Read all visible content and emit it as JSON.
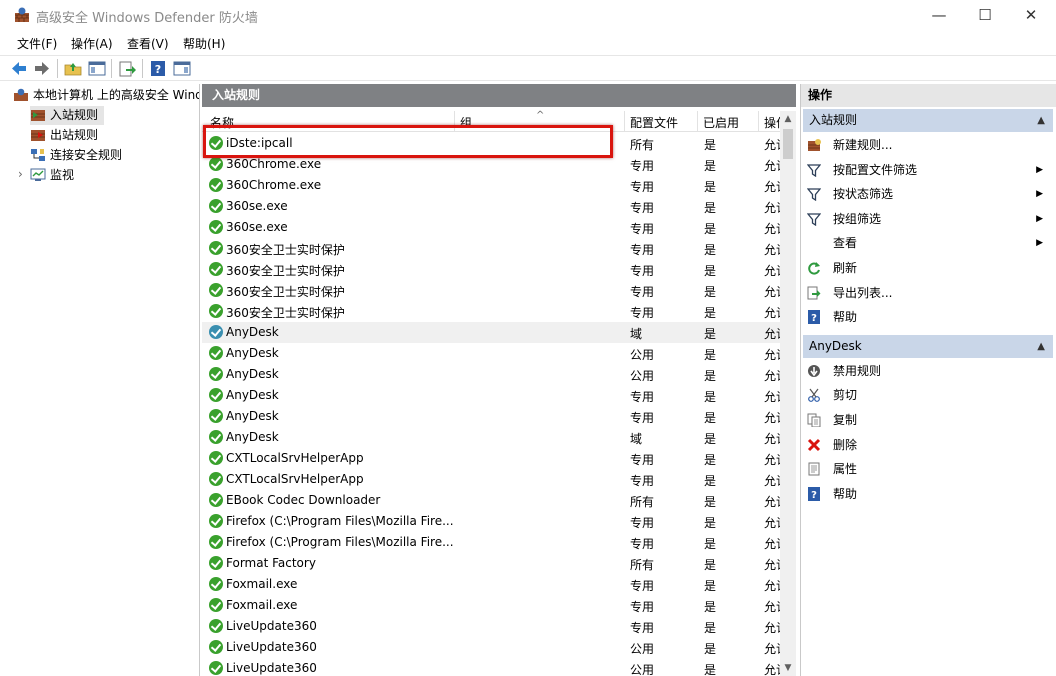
{
  "window": {
    "title": "高级安全 Windows Defender 防火墙",
    "min_glyph": "—",
    "max_glyph": "☐",
    "close_glyph": "✕"
  },
  "menu": [
    "文件(F)",
    "操作(A)",
    "查看(V)",
    "帮助(H)"
  ],
  "toolbar": {
    "icons": [
      "back-icon",
      "forward-icon",
      "up-folder-icon",
      "show-hide-tree-icon",
      "export-list-icon",
      "help-icon",
      "show-hide-action-pane-icon"
    ]
  },
  "tree": {
    "root": "本地计算机 上的高级安全 Windows",
    "items": [
      "入站规则",
      "出站规则",
      "连接安全规则",
      "监视"
    ],
    "expand_glyph": "›"
  },
  "center": {
    "title": "入站规则",
    "columns": {
      "name": "名称",
      "group": "组",
      "profile": "配置文件",
      "enabled": "已启用",
      "action": "操作"
    },
    "rows": [
      {
        "name": "iDste:ipcall",
        "profile": "所有",
        "enabled": "是",
        "action": "允许"
      },
      {
        "name": "360Chrome.exe",
        "profile": "专用",
        "enabled": "是",
        "action": "允许"
      },
      {
        "name": "360Chrome.exe",
        "profile": "专用",
        "enabled": "是",
        "action": "允许"
      },
      {
        "name": "360se.exe",
        "profile": "专用",
        "enabled": "是",
        "action": "允许"
      },
      {
        "name": "360se.exe",
        "profile": "专用",
        "enabled": "是",
        "action": "允许"
      },
      {
        "name": "360安全卫士实时保护",
        "profile": "专用",
        "enabled": "是",
        "action": "允许"
      },
      {
        "name": "360安全卫士实时保护",
        "profile": "专用",
        "enabled": "是",
        "action": "允许"
      },
      {
        "name": "360安全卫士实时保护",
        "profile": "专用",
        "enabled": "是",
        "action": "允许"
      },
      {
        "name": "360安全卫士实时保护",
        "profile": "专用",
        "enabled": "是",
        "action": "允许"
      },
      {
        "name": "AnyDesk",
        "profile": "域",
        "enabled": "是",
        "action": "允许",
        "selected": true
      },
      {
        "name": "AnyDesk",
        "profile": "公用",
        "enabled": "是",
        "action": "允许"
      },
      {
        "name": "AnyDesk",
        "profile": "公用",
        "enabled": "是",
        "action": "允许"
      },
      {
        "name": "AnyDesk",
        "profile": "专用",
        "enabled": "是",
        "action": "允许"
      },
      {
        "name": "AnyDesk",
        "profile": "专用",
        "enabled": "是",
        "action": "允许"
      },
      {
        "name": "AnyDesk",
        "profile": "域",
        "enabled": "是",
        "action": "允许"
      },
      {
        "name": "CXTLocalSrvHelperApp",
        "profile": "专用",
        "enabled": "是",
        "action": "允许"
      },
      {
        "name": "CXTLocalSrvHelperApp",
        "profile": "专用",
        "enabled": "是",
        "action": "允许"
      },
      {
        "name": "EBook Codec Downloader",
        "profile": "所有",
        "enabled": "是",
        "action": "允许"
      },
      {
        "name": "Firefox (C:\\Program Files\\Mozilla Fire...",
        "profile": "专用",
        "enabled": "是",
        "action": "允许"
      },
      {
        "name": "Firefox (C:\\Program Files\\Mozilla Fire...",
        "profile": "专用",
        "enabled": "是",
        "action": "允许"
      },
      {
        "name": "Format Factory",
        "profile": "所有",
        "enabled": "是",
        "action": "允许"
      },
      {
        "name": "Foxmail.exe",
        "profile": "专用",
        "enabled": "是",
        "action": "允许"
      },
      {
        "name": "Foxmail.exe",
        "profile": "专用",
        "enabled": "是",
        "action": "允许"
      },
      {
        "name": "LiveUpdate360",
        "profile": "专用",
        "enabled": "是",
        "action": "允许"
      },
      {
        "name": "LiveUpdate360",
        "profile": "公用",
        "enabled": "是",
        "action": "允许"
      },
      {
        "name": "LiveUpdate360",
        "profile": "公用",
        "enabled": "是",
        "action": "允许"
      }
    ]
  },
  "actions": {
    "title": "操作",
    "sections": [
      {
        "title": "入站规则",
        "items": [
          {
            "label": "新建规则...",
            "icon": "new-rule-icon",
            "submenu": false
          },
          {
            "label": "按配置文件筛选",
            "icon": "filter-icon",
            "submenu": true
          },
          {
            "label": "按状态筛选",
            "icon": "filter-icon",
            "submenu": true
          },
          {
            "label": "按组筛选",
            "icon": "filter-icon",
            "submenu": true
          },
          {
            "label": "查看",
            "icon": "",
            "submenu": true
          },
          {
            "label": "刷新",
            "icon": "refresh-icon",
            "submenu": false
          },
          {
            "label": "导出列表...",
            "icon": "export-icon",
            "submenu": false
          },
          {
            "label": "帮助",
            "icon": "help-icon",
            "submenu": false
          }
        ]
      },
      {
        "title": "AnyDesk",
        "items": [
          {
            "label": "禁用规则",
            "icon": "disable-rule-icon",
            "submenu": false
          },
          {
            "label": "剪切",
            "icon": "cut-icon",
            "submenu": false
          },
          {
            "label": "复制",
            "icon": "copy-icon",
            "submenu": false
          },
          {
            "label": "删除",
            "icon": "delete-icon",
            "submenu": false
          },
          {
            "label": "属性",
            "icon": "properties-icon",
            "submenu": false
          },
          {
            "label": "帮助",
            "icon": "help-icon",
            "submenu": false
          }
        ]
      }
    ],
    "collapse_glyph": "▲",
    "submenu_glyph": "▶"
  },
  "colors": {
    "accent_selection": "#c9d6e8",
    "enabled_icon": "#3aa12d",
    "annotation": "#d9140e"
  }
}
